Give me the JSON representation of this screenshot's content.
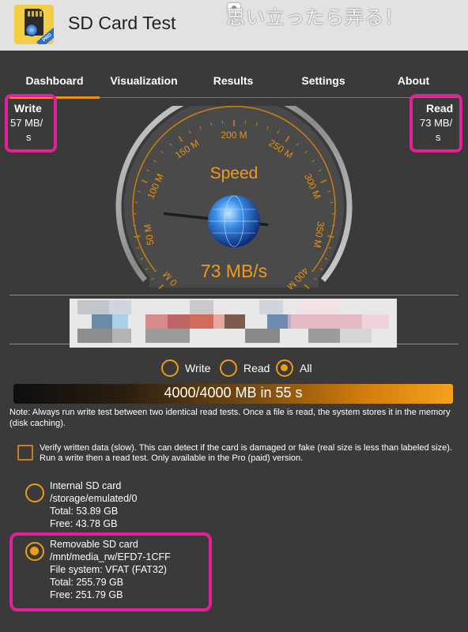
{
  "app": {
    "title": "SD Card Test",
    "watermark": "思い立ったら弄る！",
    "icon_badge": "PRO"
  },
  "tabs": [
    {
      "label": "Dashboard",
      "selected": true
    },
    {
      "label": "Visualization",
      "selected": false
    },
    {
      "label": "Results",
      "selected": false
    },
    {
      "label": "Settings",
      "selected": false
    },
    {
      "label": "About",
      "selected": false
    }
  ],
  "write": {
    "label": "Write",
    "value_line1": "57 MB/",
    "value_line2": "s"
  },
  "read": {
    "label": "Read",
    "value_line1": "73 MB/",
    "value_line2": "s"
  },
  "gauge": {
    "title": "Speed",
    "readout": "73 MB/s",
    "ticks": [
      "0 M",
      "50 M",
      "100 M",
      "150 M",
      "200 M",
      "250 M",
      "300 M",
      "350 M",
      "400 M"
    ],
    "value": 73,
    "max": 400
  },
  "mode": {
    "options": [
      {
        "label": "Write",
        "selected": false
      },
      {
        "label": "Read",
        "selected": false
      },
      {
        "label": "All",
        "selected": true
      }
    ]
  },
  "progress": {
    "text": "4000/4000 MB in 55 s",
    "fraction": 1.0
  },
  "note": "Note: Always run write test between two identical read tests. Once a file is read, the system stores it in the memory (disk caching).",
  "verify": {
    "text": "Verify written data (slow). This can detect if the card is damaged or fake (real size is less than labeled size). Run a write then a read test. Only available in the Pro (paid) version.",
    "checked": false
  },
  "cards": [
    {
      "selected": false,
      "lines": [
        "Internal SD card",
        "/storage/emulated/0",
        "Total: 53.89 GB",
        "Free: 43.78 GB"
      ]
    },
    {
      "selected": true,
      "lines": [
        "Removable SD card",
        "/mnt/media_rw/EFD7-1CFF",
        "File system: VFAT (FAT32)",
        "Total: 255.79 GB",
        "Free: 251.79 GB"
      ]
    }
  ],
  "colors": {
    "accent": "#f09a1a",
    "highlight": "#e41f9a",
    "background": "#3a3a3a"
  }
}
